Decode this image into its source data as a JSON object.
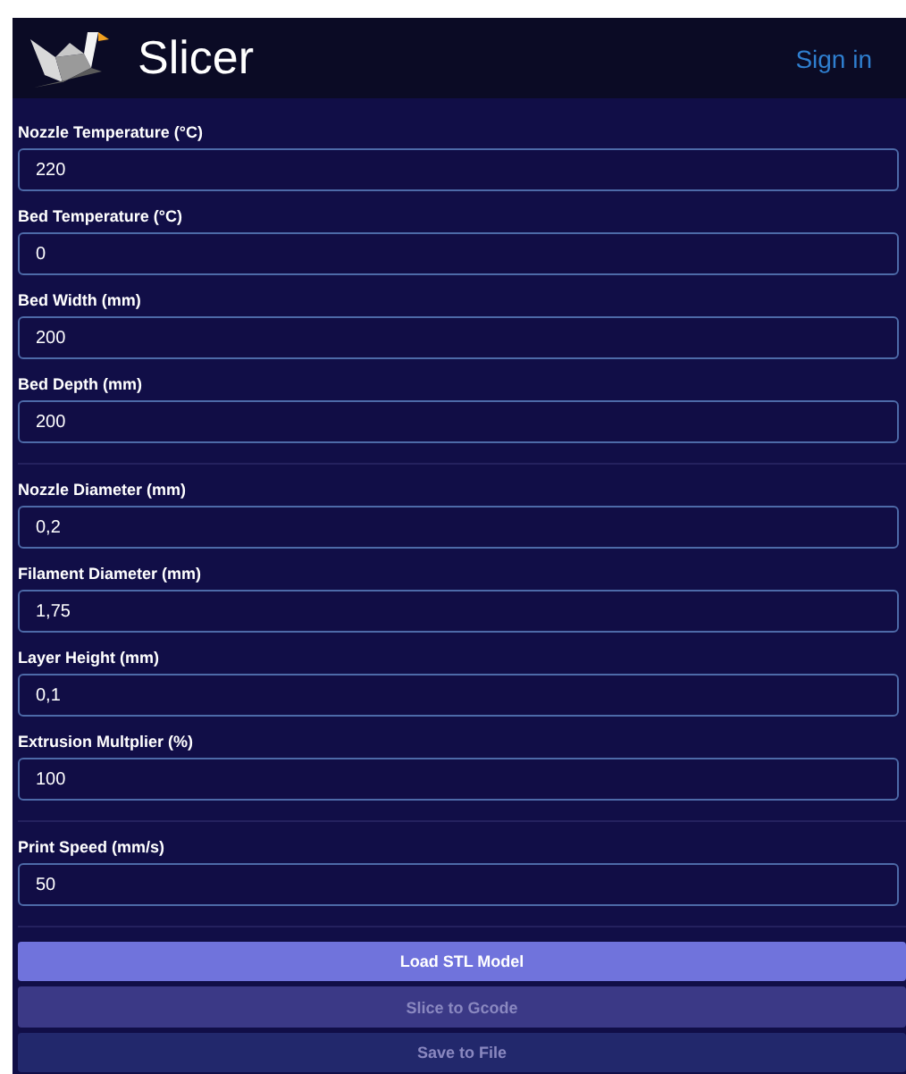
{
  "header": {
    "title": "Slicer",
    "sign_in": "Sign in"
  },
  "groups": [
    {
      "fields": [
        {
          "label": "Nozzle Temperature (°C)",
          "value": "220"
        },
        {
          "label": "Bed Temperature (°C)",
          "value": "0"
        },
        {
          "label": "Bed Width (mm)",
          "value": "200"
        },
        {
          "label": "Bed Depth (mm)",
          "value": "200"
        }
      ]
    },
    {
      "fields": [
        {
          "label": "Nozzle Diameter (mm)",
          "value": "0,2"
        },
        {
          "label": "Filament Diameter (mm)",
          "value": "1,75"
        },
        {
          "label": "Layer Height (mm)",
          "value": "0,1"
        },
        {
          "label": "Extrusion Multplier (%)",
          "value": "100"
        }
      ]
    },
    {
      "fields": [
        {
          "label": "Print Speed (mm/s)",
          "value": "50"
        }
      ]
    }
  ],
  "buttons": [
    {
      "label": "Load STL Model",
      "kind": "primary",
      "disabled": false
    },
    {
      "label": "Slice to Gcode",
      "kind": "secondary",
      "disabled": true
    },
    {
      "label": "Save to File",
      "kind": "tertiary",
      "disabled": true
    }
  ]
}
